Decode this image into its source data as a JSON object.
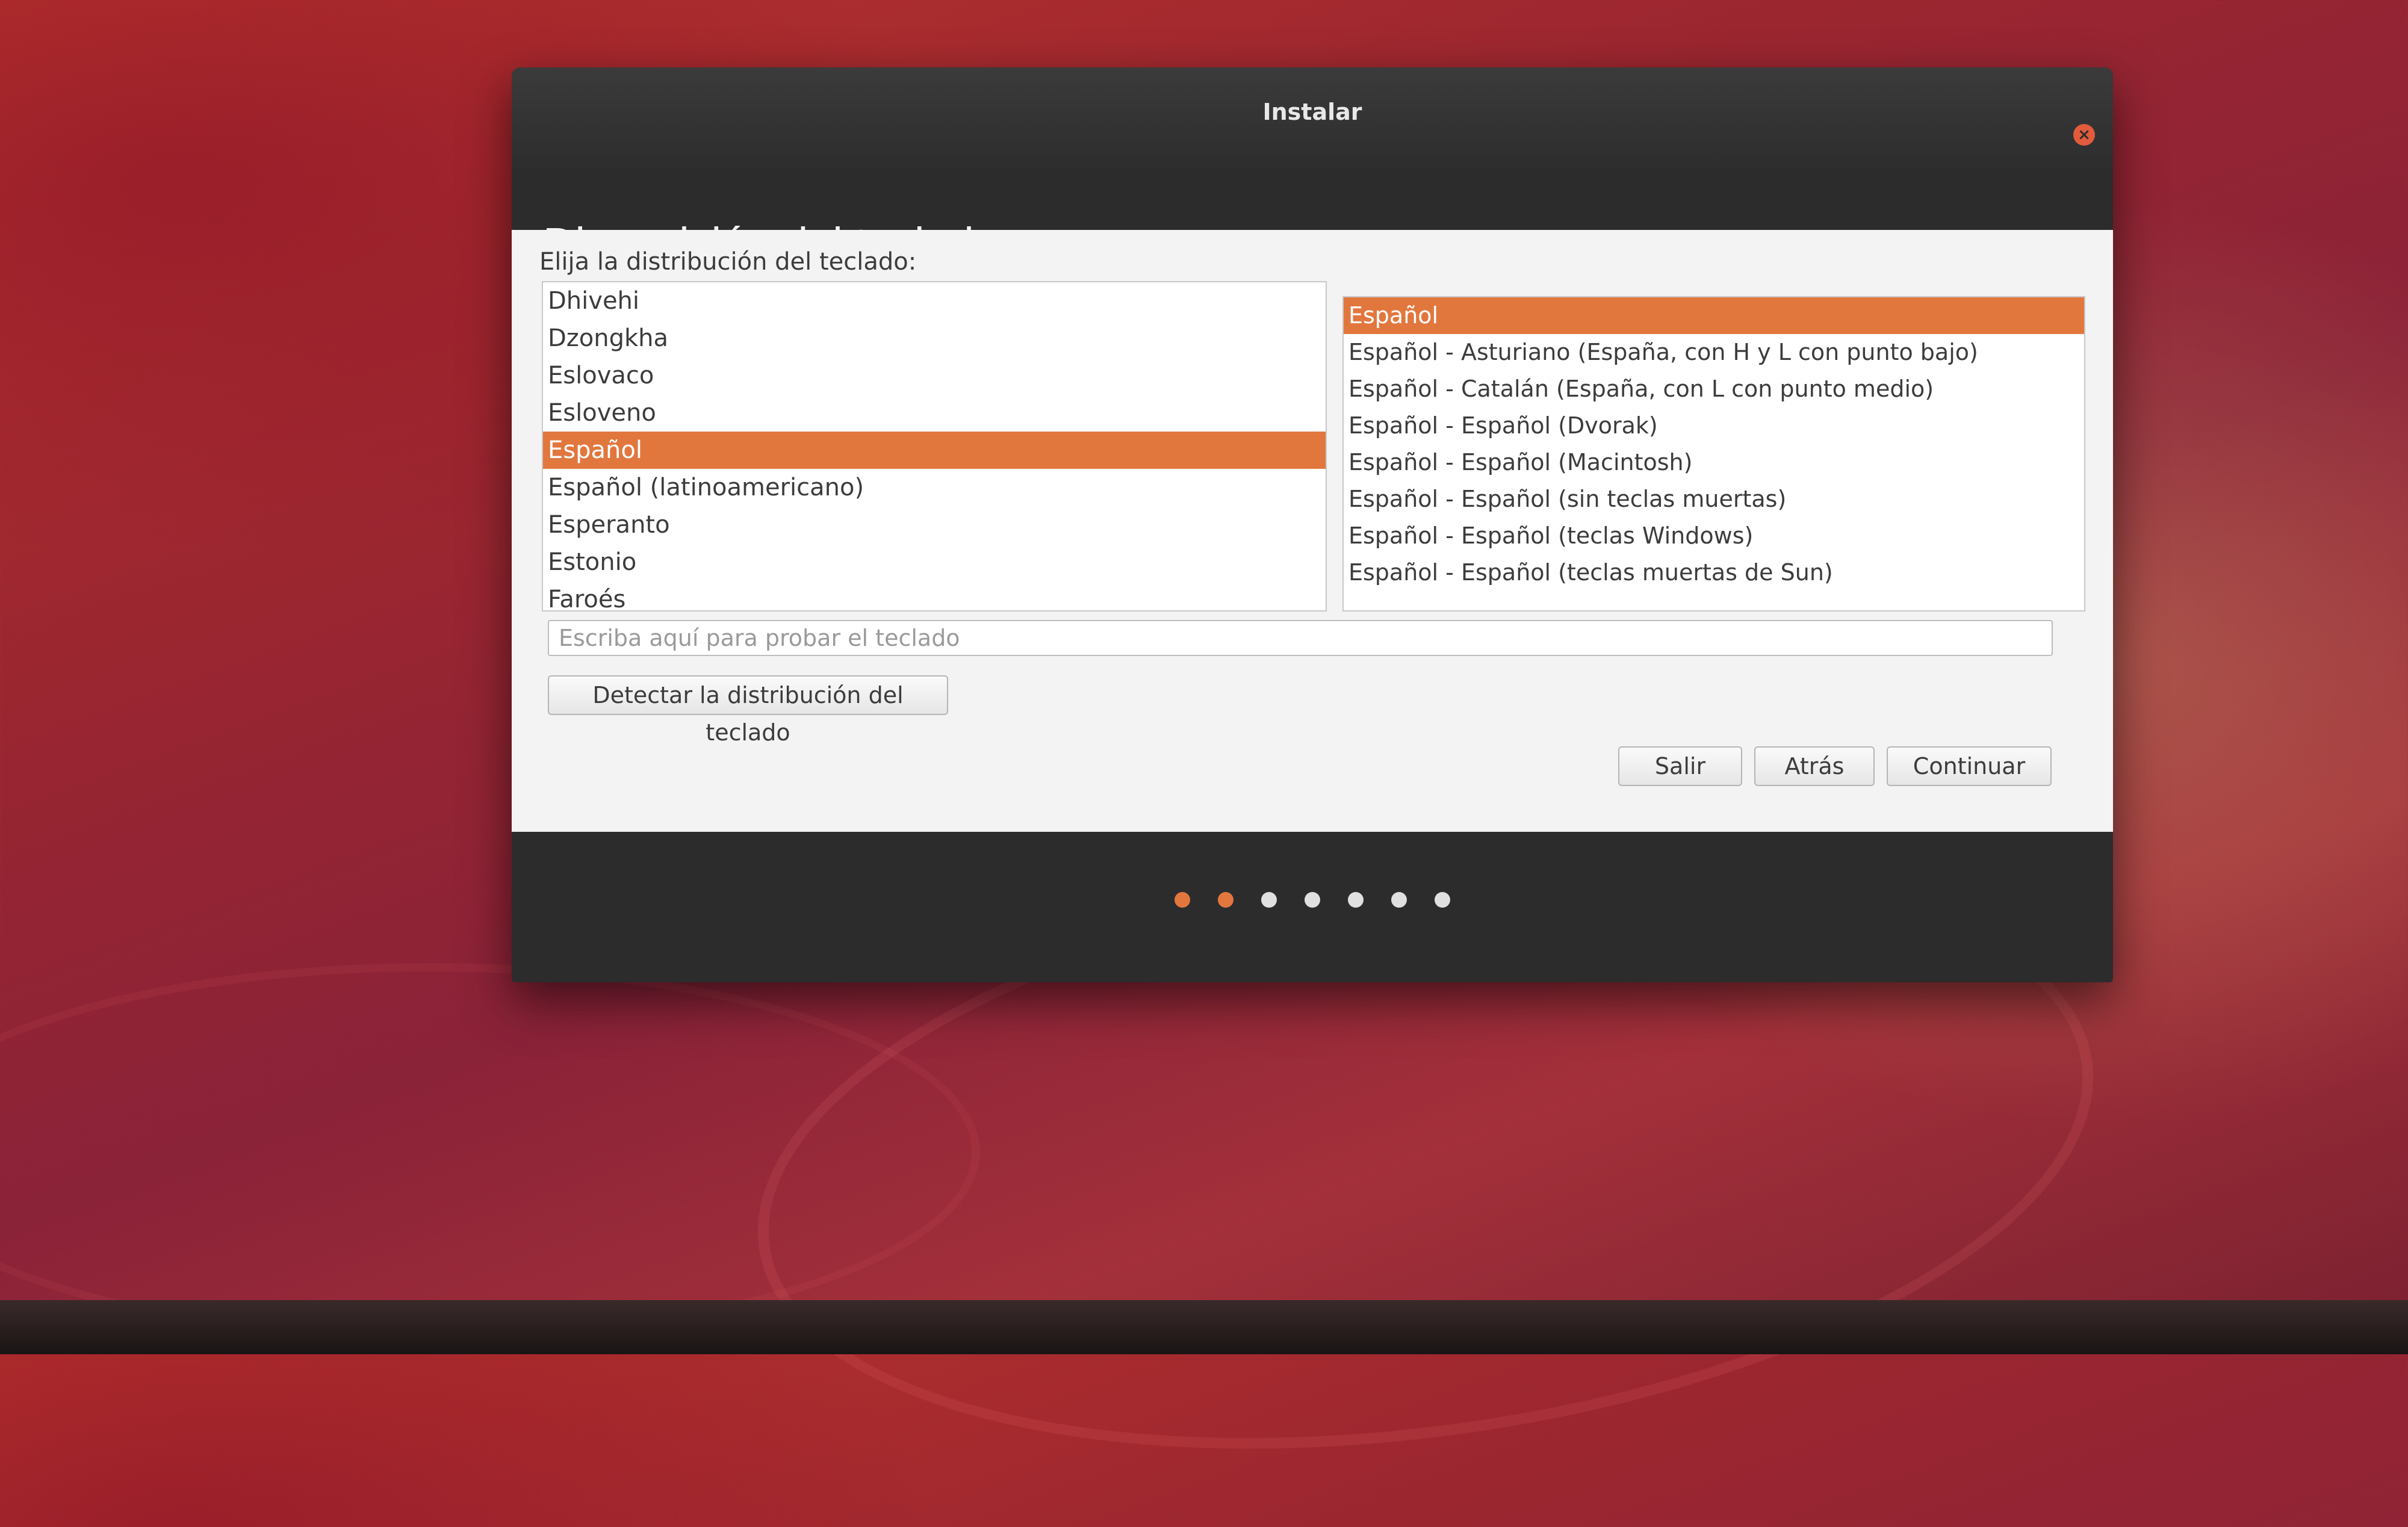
{
  "window": {
    "title": "Instalar",
    "close_icon": "close-icon",
    "heading": "Disposición del teclado"
  },
  "content": {
    "prompt": "Elija la distribución del teclado:",
    "layouts": [
      {
        "label": "Dhivehi",
        "selected": false
      },
      {
        "label": "Dzongkha",
        "selected": false
      },
      {
        "label": "Eslovaco",
        "selected": false
      },
      {
        "label": "Esloveno",
        "selected": false
      },
      {
        "label": "Español",
        "selected": true
      },
      {
        "label": "Español (latinoamericano)",
        "selected": false
      },
      {
        "label": "Esperanto",
        "selected": false
      },
      {
        "label": "Estonio",
        "selected": false
      },
      {
        "label": "Faroés",
        "selected": false
      }
    ],
    "variants": [
      {
        "label": "Español",
        "selected": true
      },
      {
        "label": "Español - Asturiano (España, con H y L con punto bajo)",
        "selected": false
      },
      {
        "label": "Español - Catalán (España, con L con punto medio)",
        "selected": false
      },
      {
        "label": "Español - Español (Dvorak)",
        "selected": false
      },
      {
        "label": "Español - Español (Macintosh)",
        "selected": false
      },
      {
        "label": "Español - Español (sin teclas muertas)",
        "selected": false
      },
      {
        "label": "Español - Español (teclas Windows)",
        "selected": false
      },
      {
        "label": "Español - Español (teclas muertas de Sun)",
        "selected": false
      }
    ],
    "test_input": {
      "placeholder": "Escriba aquí para probar el teclado",
      "value": ""
    },
    "detect_button": "Detectar la distribución del teclado"
  },
  "buttons": {
    "quit": "Salir",
    "back": "Atrás",
    "continue": "Continuar"
  },
  "progress": {
    "total_steps": 7,
    "completed_steps": 2
  },
  "colors": {
    "accent": "#e2773e",
    "titlebar": "#2c2c2c",
    "content_bg": "#f3f3f3"
  }
}
